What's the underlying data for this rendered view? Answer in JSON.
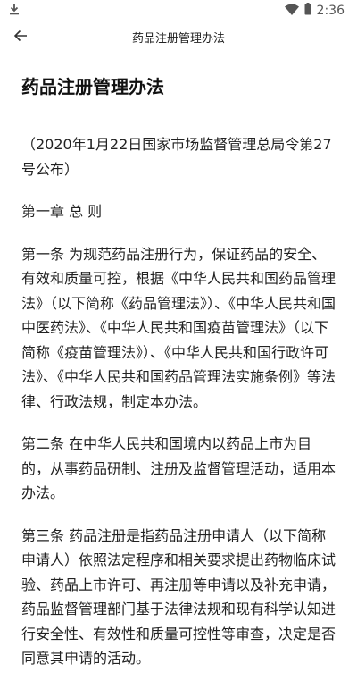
{
  "status_bar": {
    "time": "2:36",
    "download_icon": "download-icon",
    "wifi_icon": "wifi-icon",
    "battery_icon": "battery-icon"
  },
  "app_bar": {
    "title": "药品注册管理办法",
    "back_icon": "arrow-back-icon"
  },
  "document": {
    "title": "药品注册管理办法",
    "paragraphs": [
      "（2020年1月22日国家市场监督管理总局令第27号公布）",
      "第一章 总 则",
      "第一条 为规范药品注册行为，保证药品的安全、有效和质量可控，根据《中华人民共和国药品管理法》（以下简称《药品管理法》）、《中华人民共和国中医药法》、《中华人民共和国疫苗管理法》（以下简称《疫苗管理法》）、《中华人民共和国行政许可法》、《中华人民共和国药品管理法实施条例》等法律、行政法规，制定本办法。",
      "第二条 在中华人民共和国境内以药品上市为目的，从事药品研制、注册及监督管理活动，适用本办法。",
      "第三条 药品注册是指药品注册申请人（以下简称申请人）依照法定程序和相关要求提出药物临床试验、药品上市许可、再注册等申请以及补充申请，药品监督管理部门基于法律法规和现有科学认知进行安全性、有效性和质量可控性等审查，决定是否同意其申请的活动。"
    ]
  }
}
